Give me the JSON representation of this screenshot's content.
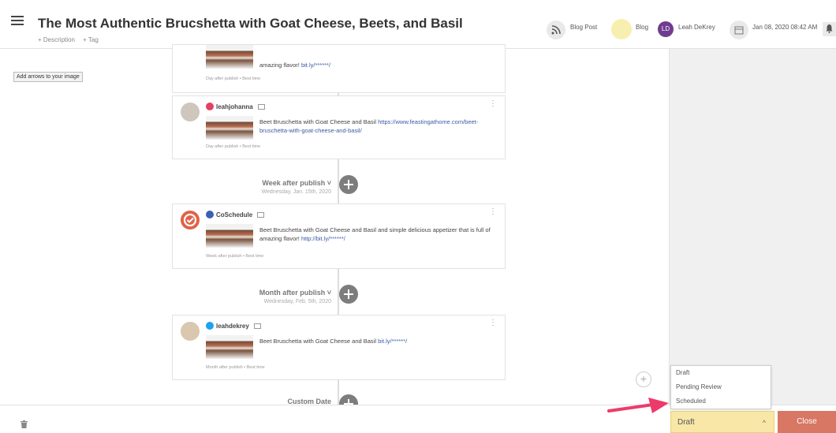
{
  "header": {
    "title": "The Most Authentic Brucshetta with Goat Cheese, Beets, and Basil",
    "add_description": "+ Description",
    "add_tag": "+ Tag",
    "type_label": "Blog Post",
    "blog_label": "Blog",
    "user_initials": "LD",
    "user_name": "Leah DeKrey",
    "date": "Jan 08, 2020 08:42 AM"
  },
  "tooltip": "Add arrows to your image",
  "cards": [
    {
      "text": "amazing flavor!",
      "link": "bit.ly/******/",
      "meta": "Day after publish • Best time"
    },
    {
      "handle": "leahjohanna",
      "text": "Beet Bruschetta with Goat Cheese and Basil",
      "link": "https://www.feastingathome.com/beet-bruschetta-with-goat-cheese-and-basil/",
      "meta": "Day after publish • Best time"
    },
    {
      "handle": "CoSchedule",
      "text": "Beet Bruschetta with Goat Cheese and Basil and simple delicious appetizer that is full of amazing flavor!",
      "link": "http://bit.ly/******/",
      "meta": "Week after publish • Best time"
    },
    {
      "handle": "leahdekrey",
      "text": "Beet Bruschetta with Goat Cheese and Basil",
      "link": "bit.ly/******/",
      "meta": "Month after publish • Best time"
    }
  ],
  "milestones": [
    {
      "title": "Week after publish ˅",
      "date": "Wednesday, Jan. 15th, 2020"
    },
    {
      "title": "Month after publish ˅",
      "date": "Wednesday, Feb. 5th, 2020"
    },
    {
      "title": "Custom Date"
    }
  ],
  "dropdown_options": [
    "Draft",
    "Pending Review",
    "Scheduled"
  ],
  "status": {
    "selected": "Draft"
  },
  "close_label": "Close",
  "colors": {
    "instagram": "#e4405f",
    "coschedule": "#3b5fb5",
    "twitter": "#1da1f2",
    "status_bg": "#f8e7a6",
    "close_bg": "#d87764",
    "arrow": "#ec3b6b"
  }
}
